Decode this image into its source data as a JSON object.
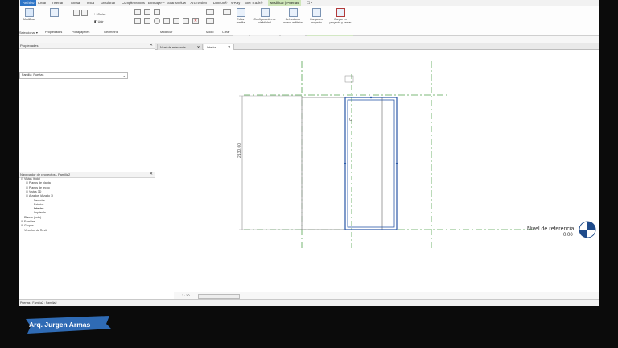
{
  "ribbon_tabs": [
    "Archivo",
    "Crear",
    "Insertar",
    "Anotar",
    "Vista",
    "Gestionar",
    "Complementos",
    "Enscape™",
    "Scansvelow",
    "ArchVision",
    "Lumion®",
    "V-Ray",
    "BIM Track®",
    "Modificar | Puertas",
    "☐ •"
  ],
  "ribbon_buttons": {
    "modificar": "Modificar",
    "seleccionar": "Seleccionar ▾",
    "propiedades": "Propiedades",
    "portapapeles": "Portapapeles",
    "cortar": "Cortar",
    "unir": "Unir",
    "geometria": "Geometría",
    "modificar_panel": "Modificar",
    "modo": "Modo",
    "crear": "Crear",
    "editar_familia": "Editar\nfamilia",
    "config_visibilidad": "Configuración de\nvisibilidad",
    "seleccionar_anfitrion": "Seleccionar\nnuevo anfitrión",
    "cargar_proyecto": "Cargar en\nproyecto",
    "cargar_cerrar": "Cargar en\nproyecto y cerrar"
  },
  "panel_labels": {
    "modo": "Modo",
    "visibilidad": "Visibilidad",
    "anfitrion": "Anfitrión",
    "editor_familias": "Editor de familias"
  },
  "properties": {
    "title": "Propiedades",
    "close": "✕",
    "type_selector": "Familia: Puertas"
  },
  "navigator": {
    "title": "Navegador de proyectos - Familia2",
    "close": "✕",
    "items": [
      {
        "label": "Vistas (todo)",
        "level": 0,
        "exp": "⊟",
        "bold": false
      },
      {
        "label": "Planos de planta",
        "level": 1,
        "exp": "⊞",
        "bold": false
      },
      {
        "label": "Planos de techo",
        "level": 1,
        "exp": "⊞",
        "bold": false
      },
      {
        "label": "Vistas 3D",
        "level": 1,
        "exp": "⊞",
        "bold": false
      },
      {
        "label": "Alzados (Alzado 1)",
        "level": 1,
        "exp": "⊟",
        "bold": false
      },
      {
        "label": "Derecha",
        "level": 2,
        "exp": "",
        "bold": false
      },
      {
        "label": "Exterior",
        "level": 2,
        "exp": "",
        "bold": false
      },
      {
        "label": "Interior",
        "level": 2,
        "exp": "",
        "bold": true
      },
      {
        "label": "Izquierda",
        "level": 2,
        "exp": "",
        "bold": false
      },
      {
        "label": "Planos (todo)",
        "level": 0,
        "exp": "",
        "bold": false
      },
      {
        "label": "Familias",
        "level": 0,
        "exp": "⊞",
        "bold": false
      },
      {
        "label": "Grupos",
        "level": 0,
        "exp": "⊞",
        "bold": false
      },
      {
        "label": "Vínculos de Revit",
        "level": 0,
        "exp": "",
        "bold": false
      }
    ]
  },
  "doc_tabs": [
    {
      "label": "Nivel de referencia",
      "active": false
    },
    {
      "label": "Interior",
      "active": true
    }
  ],
  "canvas": {
    "dimension": "2130.00",
    "level_name": "Nivel de referencia",
    "level_value": "0.00",
    "colors": {
      "sel": "#2a57a7",
      "ref": "#53a34f",
      "gray": "#8a8a8a"
    }
  },
  "viewbar": {
    "scale": "1 : 20"
  },
  "statusbar": {
    "text": "Puertas : Familia2 : Familia2"
  },
  "watermark": "Arq. Jurgen Armas"
}
